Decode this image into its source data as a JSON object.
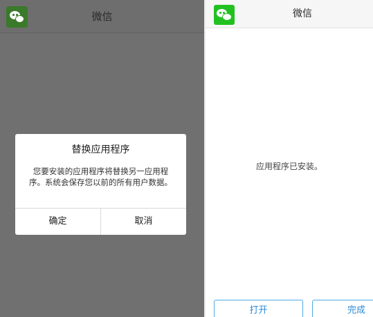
{
  "left_screen": {
    "app_title": "微信",
    "app_icon": "wechat-icon",
    "dialog": {
      "title": "替换应用程序",
      "message": "您要安装的应用程序将替换另一应用程序。系统会保存您以前的所有用户数据。",
      "confirm_label": "确定",
      "cancel_label": "取消"
    }
  },
  "right_screen": {
    "app_title": "微信",
    "app_icon": "wechat-icon",
    "status_message": "应用程序已安装。",
    "open_label": "打开",
    "done_label": "完成"
  },
  "colors": {
    "wechat_green": "#22c122",
    "wechat_green_dimmed": "#3a7a2a",
    "dim_overlay": "#707070",
    "button_border": "#4aa8e8",
    "button_text": "#2a8ad8"
  }
}
